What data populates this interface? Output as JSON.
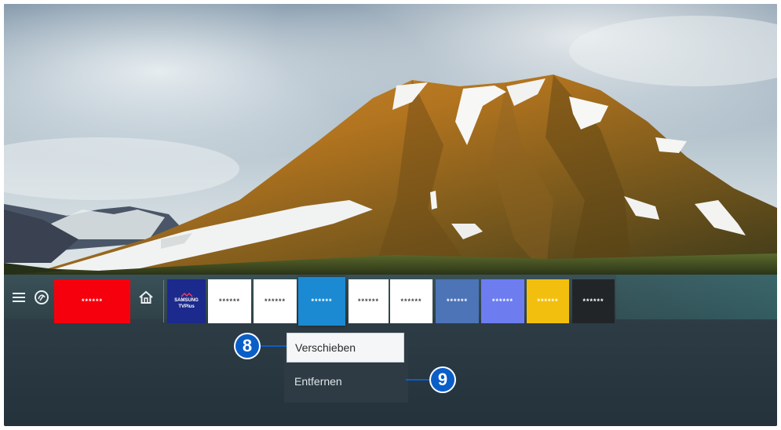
{
  "menu": {
    "nav_icons": [
      "menu-icon",
      "ambient-icon",
      "home-icon"
    ],
    "apps": [
      {
        "label": "******",
        "bg": "#f5000c",
        "fg": "#ffffff"
      },
      {
        "label": "SAMSUNG",
        "label2": "TVPlus",
        "bg": "#1b2a8c",
        "fg": "#ffffff"
      },
      {
        "label": "******",
        "bg": "#ffffff",
        "fg": "#444444"
      },
      {
        "label": "******",
        "bg": "#ffffff",
        "fg": "#444444"
      },
      {
        "label": "******",
        "bg": "#1b8ad2",
        "fg": "#ffffff"
      },
      {
        "label": "******",
        "bg": "#ffffff",
        "fg": "#444444"
      },
      {
        "label": "******",
        "bg": "#ffffff",
        "fg": "#444444"
      },
      {
        "label": "******",
        "bg": "#4c74b6",
        "fg": "#ffffff"
      },
      {
        "label": "******",
        "bg": "#6d7df0",
        "fg": "#ffffff"
      },
      {
        "label": "******",
        "bg": "#f3bf0f",
        "fg": "#ffffff"
      },
      {
        "label": "******",
        "bg": "#222528",
        "fg": "#ffffff"
      }
    ]
  },
  "context_menu": {
    "items": [
      {
        "label": "Verschieben",
        "selected": true
      },
      {
        "label": "Entfernen",
        "selected": false
      }
    ]
  },
  "callouts": {
    "move": "8",
    "remove": "9"
  },
  "colors": {
    "callout": "#0a5ec7",
    "menu_bar": "#3a5158"
  }
}
